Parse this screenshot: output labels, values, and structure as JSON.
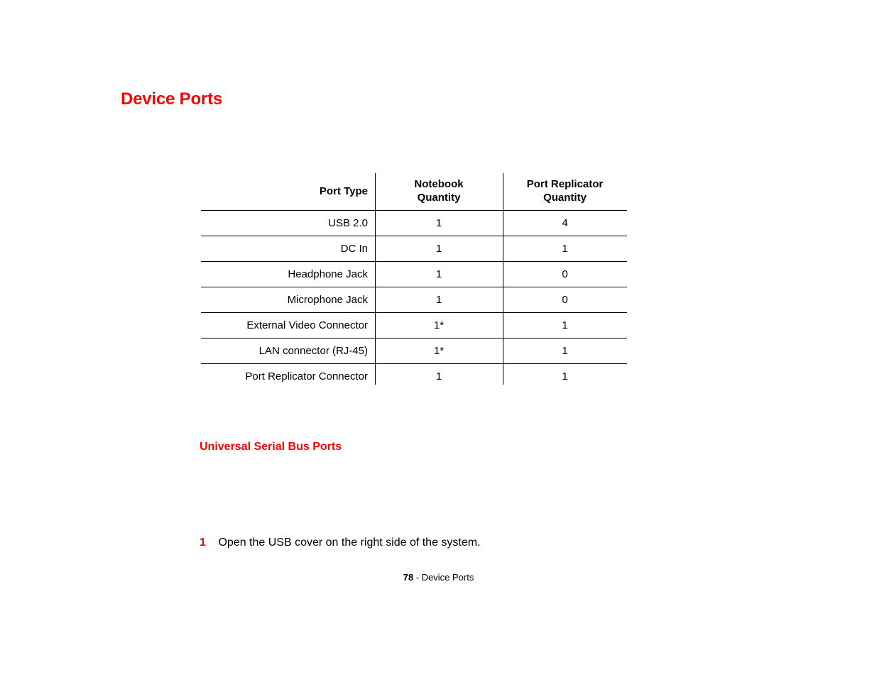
{
  "heading": "Device Ports",
  "table": {
    "headers": {
      "port_type": "Port Type",
      "notebook_l1": "Notebook",
      "notebook_l2": "Quantity",
      "replicator_l1": "Port Replicator",
      "replicator_l2": "Quantity"
    },
    "rows": [
      {
        "label": "USB 2.0",
        "notebook": "1",
        "replicator": "4"
      },
      {
        "label": "DC In",
        "notebook": "1",
        "replicator": "1"
      },
      {
        "label": "Headphone Jack",
        "notebook": "1",
        "replicator": "0"
      },
      {
        "label": "Microphone Jack",
        "notebook": "1",
        "replicator": "0"
      },
      {
        "label": "External Video Connector",
        "notebook": "1*",
        "replicator": "1"
      },
      {
        "label": "LAN connector (RJ-45)",
        "notebook": "1*",
        "replicator": "1"
      },
      {
        "label": "Port Replicator Connector",
        "notebook": "1",
        "replicator": "1"
      }
    ]
  },
  "sub_heading": "Universal Serial Bus Ports",
  "step": {
    "num": "1",
    "text": "Open the USB cover on the right side of the system."
  },
  "footer": {
    "page_num": "78",
    "sep": " - ",
    "section": "Device Ports"
  }
}
